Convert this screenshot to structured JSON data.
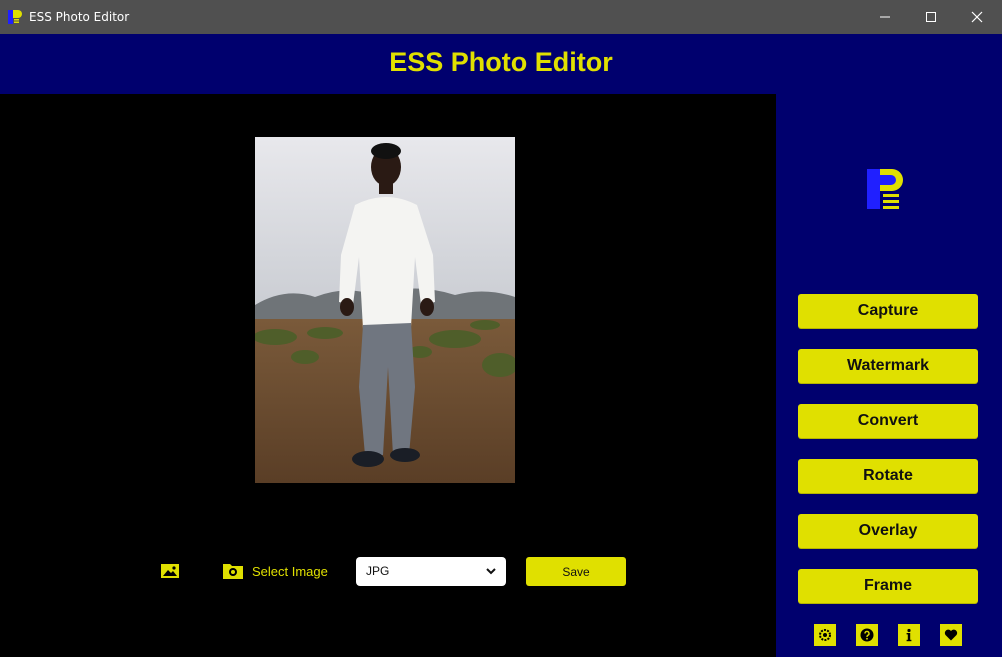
{
  "window": {
    "title": "ESS Photo Editor",
    "controls": [
      "minimize",
      "maximize",
      "close"
    ]
  },
  "header": {
    "title": "ESS Photo Editor"
  },
  "colors": {
    "accent": "#e0e000",
    "navy": "#00006e",
    "titlebar": "#505050",
    "canvas": "#000000"
  },
  "preview": {
    "subject": "photo-preview"
  },
  "toolbar": {
    "image_icon": "image-icon",
    "folder_icon": "folder-camera-icon",
    "select_label": "Select Image",
    "format": {
      "selected": "JPG"
    },
    "save_label": "Save"
  },
  "sidebar": {
    "buttons": [
      {
        "label": "Capture"
      },
      {
        "label": "Watermark"
      },
      {
        "label": "Convert"
      },
      {
        "label": "Rotate"
      },
      {
        "label": "Overlay"
      },
      {
        "label": "Frame"
      }
    ],
    "footer_icons": [
      "settings-icon",
      "help-icon",
      "info-icon",
      "heart-icon"
    ]
  }
}
